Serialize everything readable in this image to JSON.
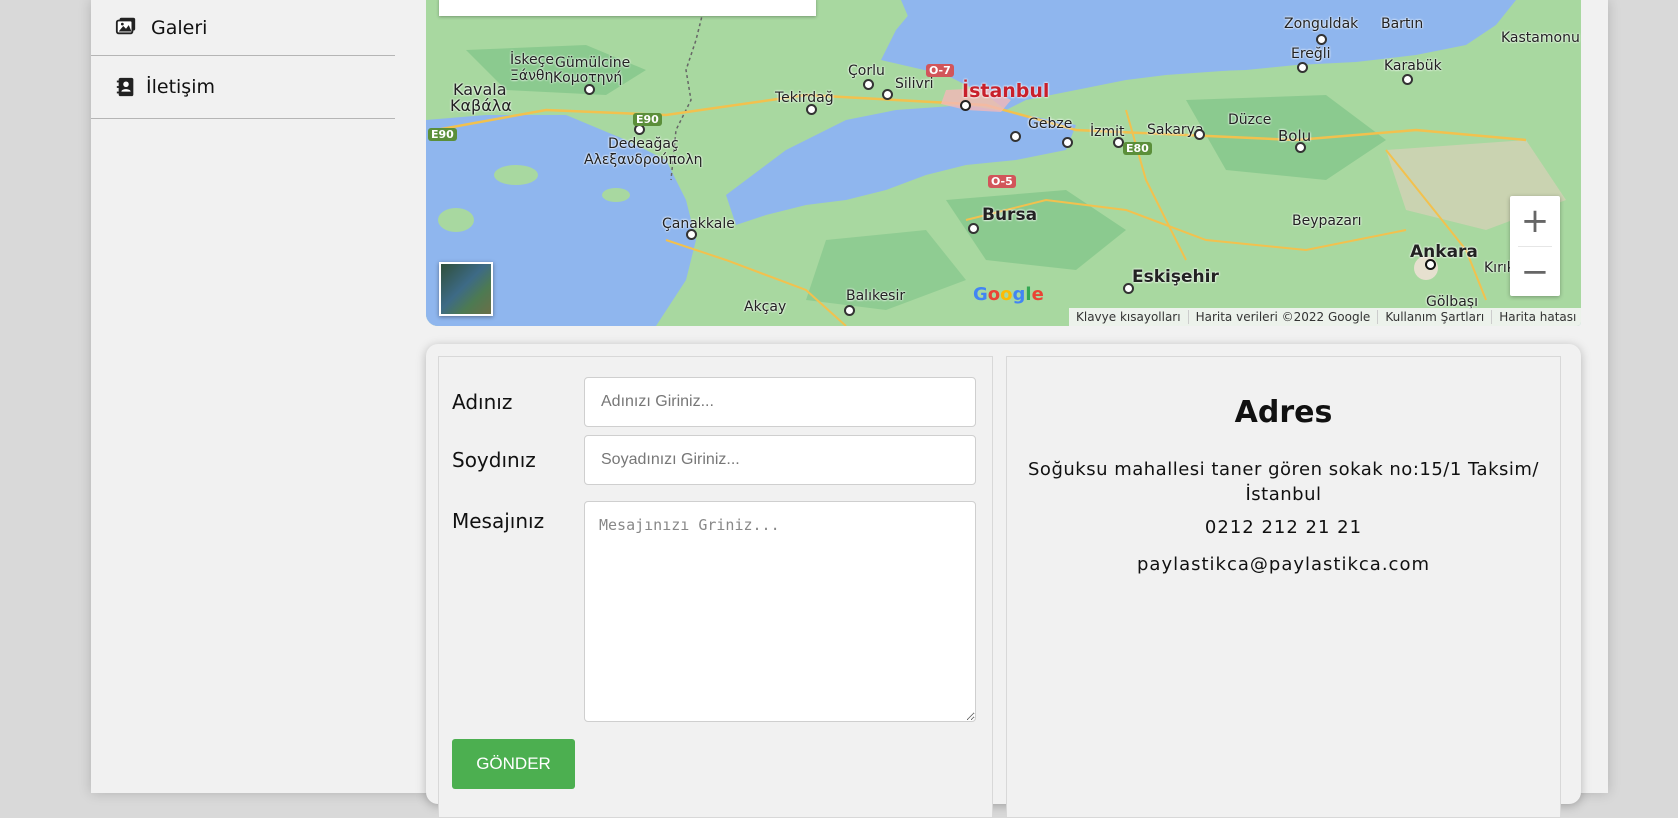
{
  "sidebar": {
    "items": [
      {
        "label": "Galeri",
        "icon": "images-icon"
      },
      {
        "label": "İletişim",
        "icon": "contact-book-icon"
      }
    ]
  },
  "map": {
    "cities": {
      "zonguldak": "Zonguldak",
      "bartin": "Bartın",
      "kastamonu": "Kastamonu",
      "eregli": "Ereğli",
      "karabuk": "Karabük",
      "iskece": "İskeçe",
      "xanthi": "Ξάνθη",
      "gumulcine": "Gümülcine",
      "komotini": "Κομοτηνή",
      "kavala": "Kavala",
      "kavala_gr": "Καβάλα",
      "corlu": "Çorlu",
      "silivri": "Silivri",
      "tekirdag": "Tekirdağ",
      "istanbul": "İstanbul",
      "gebze": "Gebze",
      "izmit": "İzmit",
      "sakarya": "Sakarya",
      "duzce": "Düzce",
      "bolu": "Bolu",
      "dedeagac": "Dedeağaç",
      "alexandroupoli": "Αλεξανδρούπολη",
      "canakkale": "Çanakkale",
      "bursa": "Bursa",
      "beypazari": "Beypazarı",
      "ankara": "Ankara",
      "kirikkale": "Kırıkk",
      "eskisehir": "Eskişehir",
      "balikesir": "Balıkesir",
      "akcay": "Akçay",
      "golbasi": "Gölbaşı"
    },
    "roads": {
      "e90a": "E90",
      "e90b": "E90",
      "e80": "E80",
      "o7": "O-7",
      "o5": "O-5"
    },
    "zoom_in": "+",
    "zoom_out": "−",
    "google": [
      "G",
      "o",
      "o",
      "g",
      "l",
      "e"
    ],
    "attribution": {
      "shortcuts": "Klavye kısayolları",
      "data": "Harita verileri ©2022 Google",
      "terms": "Kullanım Şartları",
      "report": "Harita hatası bildirin"
    }
  },
  "form": {
    "name_label": "Adınız",
    "name_placeholder": "Adınızı Giriniz...",
    "surname_label": "Soydınız",
    "surname_placeholder": "Soyadınızı Giriniz...",
    "message_label": "Mesajınız",
    "message_placeholder": "Mesajınızı Griniz...",
    "submit_label": "GÖNDER"
  },
  "address": {
    "title": "Adres",
    "text": "Soğuksu mahallesi taner gören sokak no:15/1 Taksim/ İstanbul",
    "phone": "0212 212 21 21",
    "email": "paylastikca@paylastikca.com"
  },
  "colors": {
    "accent_button": "#4caf50",
    "sea": "#8fb6ee",
    "land": "#9dd39a",
    "istanbul_label": "#c8202b"
  }
}
